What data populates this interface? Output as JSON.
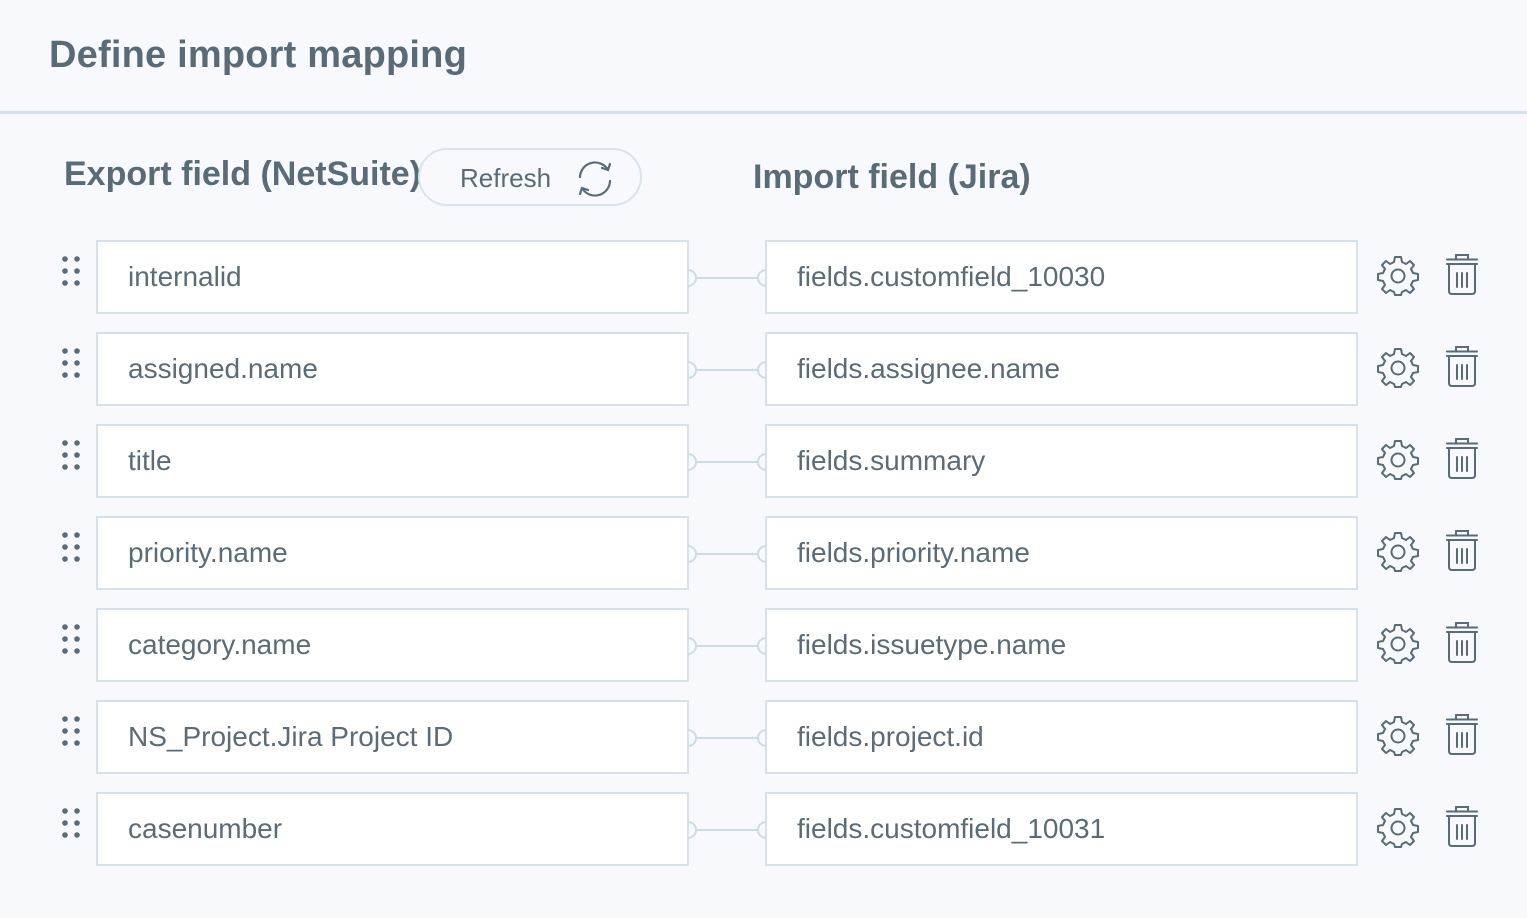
{
  "header": {
    "title": "Define import mapping"
  },
  "columns": {
    "export_heading": "Export field (NetSuite)",
    "import_heading": "Import field (Jira)",
    "refresh_label": "Refresh"
  },
  "mappings": [
    {
      "export": "internalid",
      "import": "fields.customfield_10030"
    },
    {
      "export": "assigned.name",
      "import": "fields.assignee.name"
    },
    {
      "export": "title",
      "import": "fields.summary"
    },
    {
      "export": "priority.name",
      "import": "fields.priority.name"
    },
    {
      "export": "category.name",
      "import": "fields.issuetype.name"
    },
    {
      "export": "NS_Project.Jira Project ID",
      "import": "fields.project.id"
    },
    {
      "export": "casenumber",
      "import": "fields.customfield_10031"
    }
  ],
  "icons": {
    "drag": "drag-handle-icon",
    "settings": "gear-icon",
    "delete": "trash-icon",
    "refresh": "refresh-icon"
  },
  "colors": {
    "background": "#f7f9fc",
    "text": "#5b6b78",
    "border": "#d6e2ea",
    "icon": "#5a6b78"
  }
}
